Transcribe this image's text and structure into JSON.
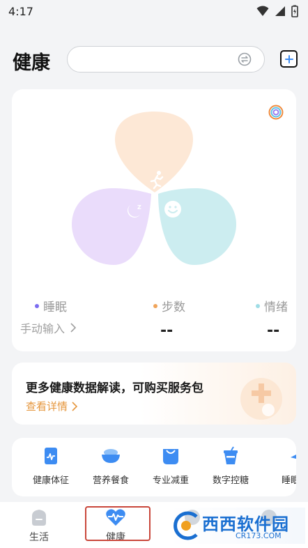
{
  "status_bar": {
    "time": "4:17"
  },
  "header": {
    "title": "健康",
    "search_placeholder": ""
  },
  "health_card": {
    "legend": [
      {
        "label": "睡眠",
        "color": "#7b6cf0"
      },
      {
        "label": "步数",
        "color": "#f0a45a"
      },
      {
        "label": "情绪",
        "color": "#9fdde6"
      }
    ],
    "manual_input": "手动输入",
    "steps_value": "--",
    "mood_value": "--",
    "petal_colors": {
      "steps": "#fde8d6",
      "sleep": "#eadcfb",
      "mood": "#ccedf0"
    }
  },
  "promo": {
    "title": "更多健康数据解读，可购买服务包",
    "link": "查看详情"
  },
  "shortcuts": [
    {
      "label": "健康体征",
      "icon": "vital-signs-icon"
    },
    {
      "label": "营养餐食",
      "icon": "meal-bowl-icon"
    },
    {
      "label": "专业减重",
      "icon": "weight-scale-icon"
    },
    {
      "label": "数字控糖",
      "icon": "sugar-cup-icon"
    },
    {
      "label": "睡眠",
      "icon": "sleep-moon-icon"
    }
  ],
  "bottom_nav": [
    {
      "label": "生活",
      "icon": "home-icon"
    },
    {
      "label": "健康",
      "icon": "heartbeat-icon",
      "active": true
    },
    {
      "label": "",
      "icon": "chat-icon"
    },
    {
      "label": "",
      "icon": "profile-icon"
    }
  ],
  "watermark": {
    "cn": "西西软件园",
    "en": "CR173.COM"
  },
  "colors": {
    "accent": "#3d8cf2",
    "link_orange": "#e5963c",
    "highlight_red": "#c9463a"
  }
}
